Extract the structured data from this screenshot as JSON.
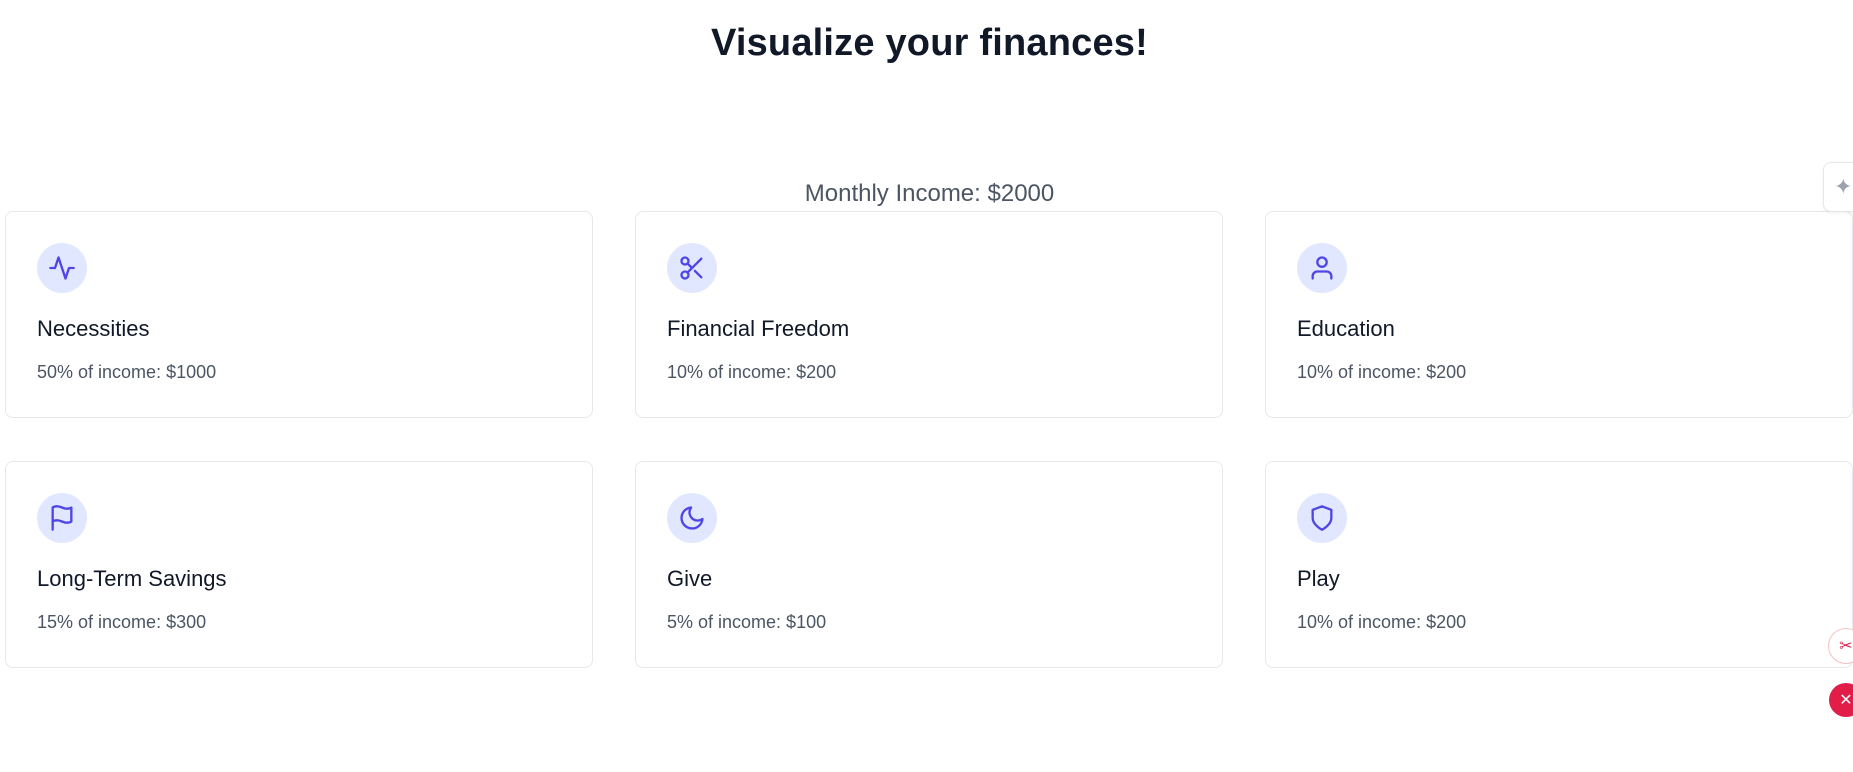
{
  "header": {
    "title": "Visualize your finances!"
  },
  "income": {
    "label": "Monthly Income: $2000",
    "amount": 2000
  },
  "colors": {
    "accent": "#4f46e5",
    "icon_bg": "#e0e7ff",
    "border": "#e5e7eb",
    "muted_text": "#4b5563"
  },
  "categories": [
    {
      "icon": "activity-icon",
      "title": "Necessities",
      "desc": "50% of income: $1000",
      "percent": 50,
      "amount": 1000
    },
    {
      "icon": "scissors-icon",
      "title": "Financial Freedom",
      "desc": "10% of income: $200",
      "percent": 10,
      "amount": 200
    },
    {
      "icon": "user-icon",
      "title": "Education",
      "desc": "10% of income: $200",
      "percent": 10,
      "amount": 200
    },
    {
      "icon": "flag-icon",
      "title": "Long-Term Savings",
      "desc": "15% of income: $300",
      "percent": 15,
      "amount": 300
    },
    {
      "icon": "moon-icon",
      "title": "Give",
      "desc": "5% of income: $100",
      "percent": 5,
      "amount": 100
    },
    {
      "icon": "shield-icon",
      "title": "Play",
      "desc": "10% of income: $200",
      "percent": 10,
      "amount": 200
    }
  ],
  "overlay": {
    "extension_tab_icon": "puzzle-icon",
    "float_button_1_icon": "scissors-icon",
    "float_button_2_icon": "close-icon"
  }
}
